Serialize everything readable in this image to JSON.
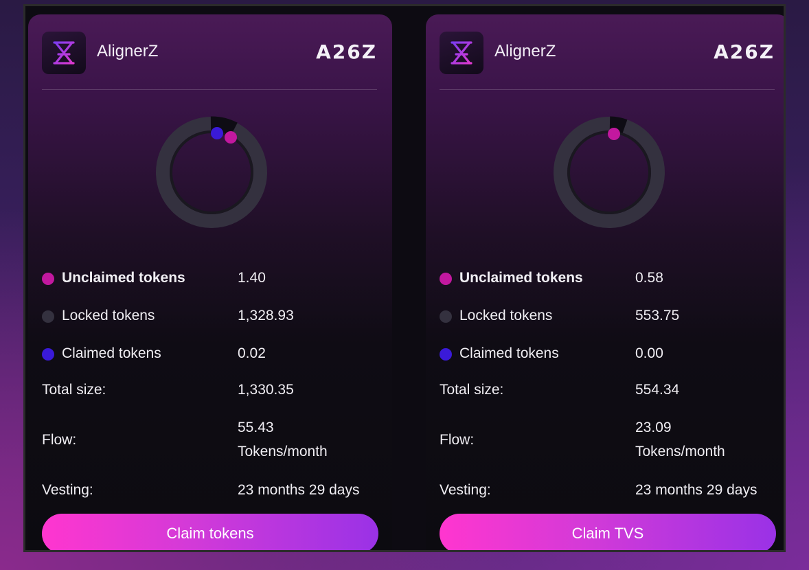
{
  "colors": {
    "unclaimed": "#c2189f",
    "locked": "#34313f",
    "claimed": "#3a1ad8",
    "button_start": "#ff36cf",
    "button_end": "#9a32e6"
  },
  "cards": [
    {
      "app_name": "AlignerZ",
      "brand": "A26Z",
      "logo_icon": "hourglass-icon",
      "rows": {
        "unclaimed": {
          "label": "Unclaimed tokens",
          "value": "1.40"
        },
        "locked": {
          "label": "Locked tokens",
          "value": "1,328.93"
        },
        "claimed": {
          "label": "Claimed tokens",
          "value": "0.02"
        },
        "total": {
          "label": "Total size:",
          "value": "1,330.35"
        },
        "flow": {
          "label": "Flow:",
          "value": "55.43",
          "unit": "Tokens/month"
        },
        "vesting": {
          "label": "Vesting:",
          "value": "23 months 29 days"
        }
      },
      "button_label": "Claim tokens"
    },
    {
      "app_name": "AlignerZ",
      "brand": "A26Z",
      "logo_icon": "hourglass-icon",
      "rows": {
        "unclaimed": {
          "label": "Unclaimed tokens",
          "value": "0.58"
        },
        "locked": {
          "label": "Locked tokens",
          "value": "553.75"
        },
        "claimed": {
          "label": "Claimed tokens",
          "value": "0.00"
        },
        "total": {
          "label": "Total size:",
          "value": "554.34"
        },
        "flow": {
          "label": "Flow:",
          "value": "23.09",
          "unit": "Tokens/month"
        },
        "vesting": {
          "label": "Vesting:",
          "value": "23 months 29 days"
        }
      },
      "button_label": "Claim TVS"
    }
  ]
}
